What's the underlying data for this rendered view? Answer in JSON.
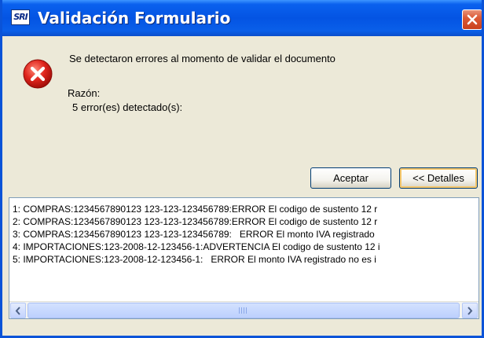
{
  "window": {
    "title": "Validación Formulario",
    "app_icon": "SRI",
    "close_icon": "close-icon"
  },
  "message": {
    "main": "Se detectaron errores al momento de validar el documento",
    "reason_label": "Razón:",
    "reason_text": "5 error(es) detectado(s):",
    "icon": "error-icon"
  },
  "buttons": {
    "accept": "Aceptar",
    "details": "<< Detalles"
  },
  "details": {
    "lines": [
      "1: COMPRAS:1234567890123 123-123-123456789:ERROR El codigo de sustento 12 r",
      "2: COMPRAS:1234567890123 123-123-123456789:ERROR El codigo de sustento 12 r",
      "3: COMPRAS:1234567890123 123-123-123456789:   ERROR El monto IVA registrado",
      "4: IMPORTACIONES:123-2008-12-123456-1:ADVERTENCIA El codigo de sustento 12 i",
      "5: IMPORTACIONES:123-2008-12-123456-1:   ERROR El monto IVA registrado no es i"
    ]
  },
  "colors": {
    "titlebar": "#0454e3",
    "window_bg": "#ece9d8",
    "error_red": "#e0261e"
  }
}
